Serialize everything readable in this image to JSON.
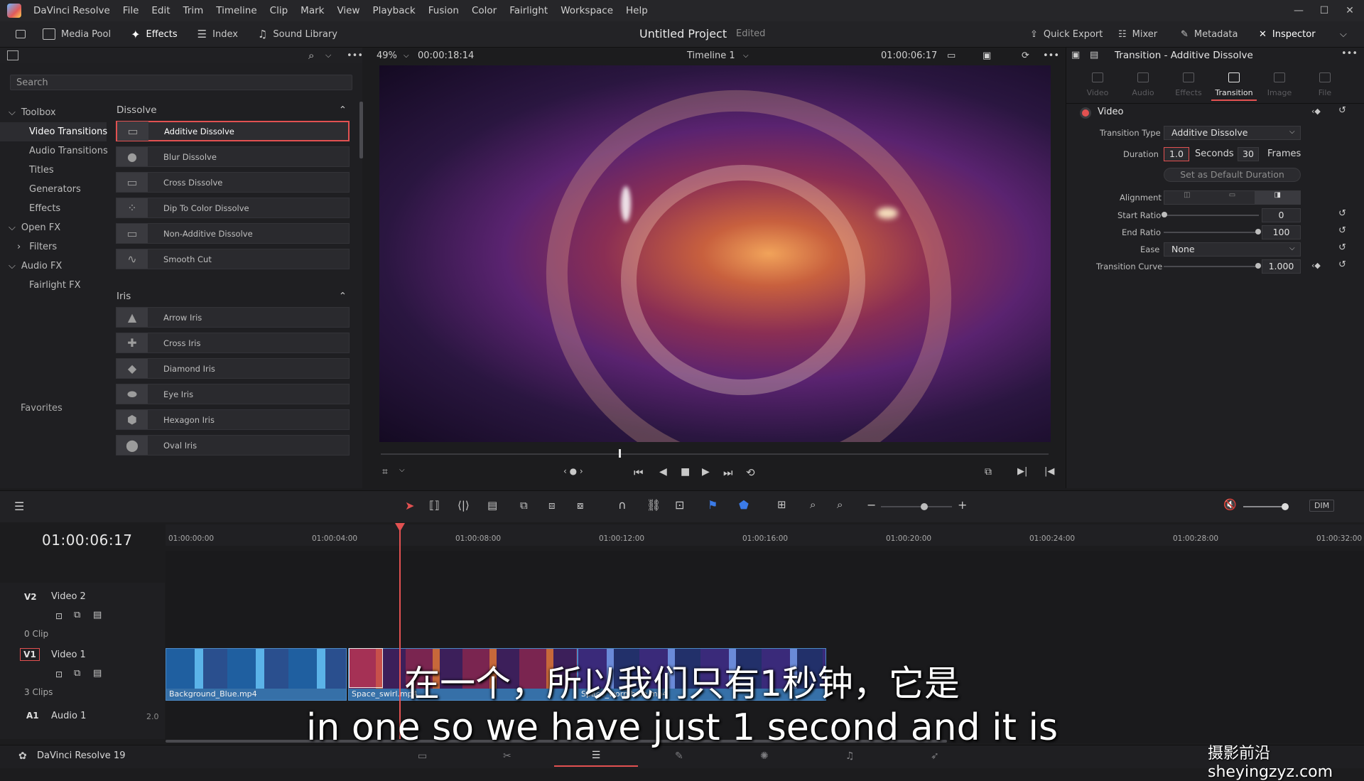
{
  "menubar": {
    "app": "DaVinci Resolve",
    "items": [
      "File",
      "Edit",
      "Trim",
      "Timeline",
      "Clip",
      "Mark",
      "View",
      "Playback",
      "Fusion",
      "Color",
      "Fairlight",
      "Workspace",
      "Help"
    ]
  },
  "toolbar": {
    "media_pool": "Media Pool",
    "effects": "Effects",
    "index": "Index",
    "sound_library": "Sound Library",
    "project_title": "Untitled Project",
    "project_status": "Edited",
    "quick_export": "Quick Export",
    "mixer": "Mixer",
    "metadata": "Metadata",
    "inspector": "Inspector"
  },
  "effects_panel": {
    "search_placeholder": "Search",
    "tree": [
      {
        "label": "Toolbox",
        "caret": "⌵"
      },
      {
        "label": "Video Transitions",
        "selected": true
      },
      {
        "label": "Audio Transitions"
      },
      {
        "label": "Titles"
      },
      {
        "label": "Generators"
      },
      {
        "label": "Effects"
      },
      {
        "label": "Open FX",
        "caret": "⌵"
      },
      {
        "label": "Filters",
        "caret": "›"
      },
      {
        "label": "Audio FX",
        "caret": "⌵"
      },
      {
        "label": "Fairlight FX"
      }
    ],
    "favorites": "Favorites",
    "groups": [
      {
        "name": "Dissolve",
        "items": [
          "Additive Dissolve",
          "Blur Dissolve",
          "Cross Dissolve",
          "Dip To Color Dissolve",
          "Non-Additive Dissolve",
          "Smooth Cut"
        ]
      },
      {
        "name": "Iris",
        "items": [
          "Arrow Iris",
          "Cross Iris",
          "Diamond Iris",
          "Eye Iris",
          "Hexagon Iris",
          "Oval Iris"
        ]
      }
    ]
  },
  "viewer": {
    "zoom": "49%",
    "source_timecode": "00:00:18:14",
    "timeline_name": "Timeline 1",
    "record_timecode": "01:00:06:17"
  },
  "inspector": {
    "title": "Transition - Additive Dissolve",
    "tabs": [
      "Video",
      "Audio",
      "Effects",
      "Transition",
      "Image",
      "File"
    ],
    "active_tab": "Transition",
    "section": "Video",
    "transition_type_label": "Transition Type",
    "transition_type": "Additive Dissolve",
    "duration_label": "Duration",
    "duration_seconds": "1.0",
    "seconds_label": "Seconds",
    "duration_frames": "30",
    "frames_label": "Frames",
    "default_duration_button": "Set as Default Duration",
    "alignment_label": "Alignment",
    "start_ratio_label": "Start Ratio",
    "start_ratio": "0",
    "end_ratio_label": "End Ratio",
    "end_ratio": "100",
    "ease_label": "Ease",
    "ease": "None",
    "curve_label": "Transition Curve",
    "curve": "1.000"
  },
  "timeline": {
    "timecode": "01:00:06:17",
    "ruler": [
      "01:00:00:00",
      "01:00:04:00",
      "01:00:08:00",
      "01:00:12:00",
      "01:00:16:00",
      "01:00:20:00",
      "01:00:24:00",
      "01:00:28:00",
      "01:00:32:00"
    ],
    "tracks": [
      {
        "id": "V2",
        "name": "Video 2",
        "clips": "0 Clip"
      },
      {
        "id": "V1",
        "name": "Video 1",
        "clips": "3 Clips"
      },
      {
        "id": "A1",
        "name": "Audio 1",
        "level": "2.0"
      }
    ],
    "clips": [
      "Background_Blue.mp4",
      "Space_swirl.mp4",
      "Space_wormhole.mp4"
    ],
    "dim": "DIM"
  },
  "bottombar": {
    "app_version": "DaVinci Resolve 19"
  },
  "subtitles": {
    "chinese": "在一个，所以我们只有1秒钟，它是",
    "english": "in one so we have just 1 second and it is"
  },
  "watermark": "摄影前沿 sheyingzyz.com"
}
